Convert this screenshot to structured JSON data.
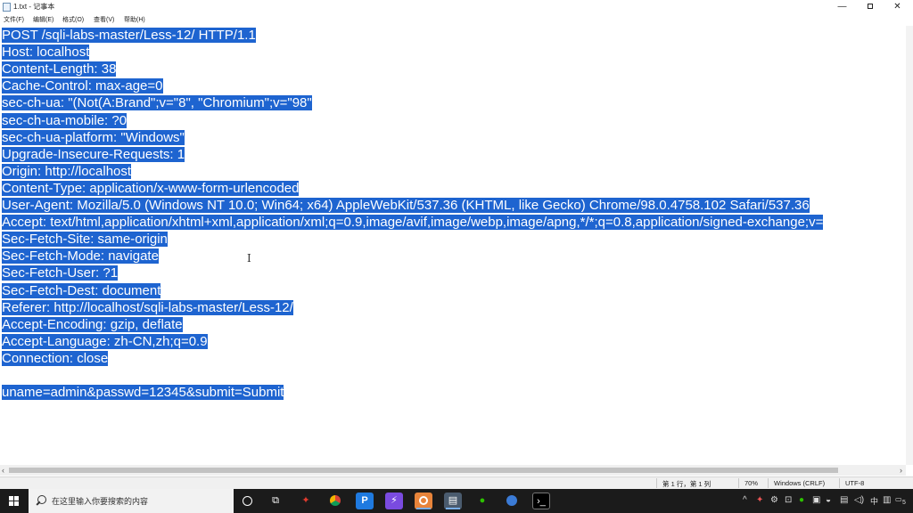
{
  "window": {
    "title": "1.txt - 记事本",
    "minimize_glyph": "—",
    "close_glyph": "✕"
  },
  "menu": [
    {
      "label": "文件(F)"
    },
    {
      "label": "编辑(E)"
    },
    {
      "label": "格式(O)"
    },
    {
      "label": "查看(V)"
    },
    {
      "label": "帮助(H)"
    }
  ],
  "editor": {
    "lines": [
      "POST /sqli-labs-master/Less-12/ HTTP/1.1",
      "Host: localhost",
      "Content-Length: 38",
      "Cache-Control: max-age=0",
      "sec-ch-ua: \"(Not(A:Brand\";v=\"8\", \"Chromium\";v=\"98\"",
      "sec-ch-ua-mobile: ?0",
      "sec-ch-ua-platform: \"Windows\"",
      "Upgrade-Insecure-Requests: 1",
      "Origin: http://localhost",
      "Content-Type: application/x-www-form-urlencoded",
      "User-Agent: Mozilla/5.0 (Windows NT 10.0; Win64; x64) AppleWebKit/537.36 (KHTML, like Gecko) Chrome/98.0.4758.102 Safari/537.36",
      "Accept: text/html,application/xhtml+xml,application/xml;q=0.9,image/avif,image/webp,image/apng,*/*;q=0.8,application/signed-exchange;v=",
      "Sec-Fetch-Site: same-origin",
      "Sec-Fetch-Mode: navigate",
      "Sec-Fetch-User: ?1",
      "Sec-Fetch-Dest: document",
      "Referer: http://localhost/sqli-labs-master/Less-12/",
      "Accept-Encoding: gzip, deflate",
      "Accept-Language: zh-CN,zh;q=0.9",
      "Connection: close",
      "",
      "uname=admin&passwd=12345&submit=Submit"
    ],
    "selection_color": "#1e64d0"
  },
  "statusbar": {
    "position": "第 1 行，第 1 列",
    "zoom": "70%",
    "line_ending": "Windows (CRLF)",
    "encoding": "UTF-8"
  },
  "taskbar": {
    "search_placeholder": "在这里输入你要搜索的内容",
    "tray_ime": "中",
    "tray_clock_hint": "5"
  }
}
